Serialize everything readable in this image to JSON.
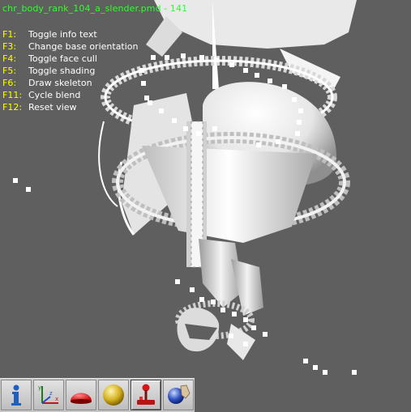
{
  "window": {
    "title": "chr_body_rank_104_a_slender.pmd - 141"
  },
  "help": [
    {
      "key": "F1:",
      "label": "Toggle info text"
    },
    {
      "key": "F3:",
      "label": "Change base orientation"
    },
    {
      "key": "F4:",
      "label": "Toggle face cull"
    },
    {
      "key": "F5:",
      "label": "Toggle shading"
    },
    {
      "key": "F6:",
      "label": "Draw skeleton"
    },
    {
      "key": "F11:",
      "label": "Cycle blend"
    },
    {
      "key": "F12:",
      "label": "Reset view"
    }
  ],
  "toolbar": {
    "tools": [
      {
        "icon": "info-icon"
      },
      {
        "icon": "axes-icon"
      },
      {
        "icon": "red-dome-icon"
      },
      {
        "icon": "yellow-sphere-icon"
      },
      {
        "icon": "joystick-icon"
      },
      {
        "icon": "sphere-hand-icon"
      }
    ]
  },
  "colors": {
    "background": "#5f5f5f",
    "title": "#2cff2c",
    "key": "#ffff00",
    "text": "#ffffff"
  }
}
